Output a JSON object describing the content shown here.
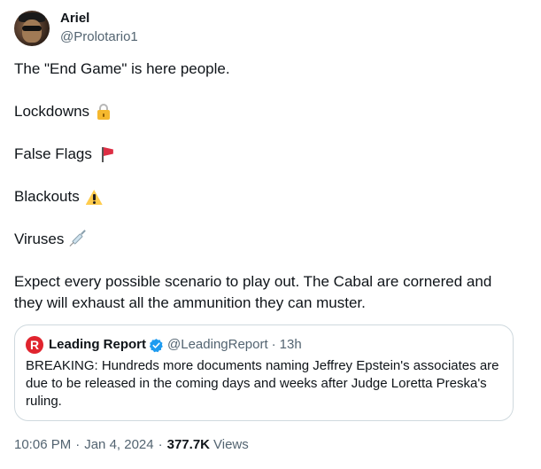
{
  "author": {
    "display_name": "Ariel",
    "handle": "@Prolotario1"
  },
  "tweet": {
    "intro": "The \"End Game\" is here people.",
    "items": [
      {
        "label": "Lockdowns",
        "icon": "lock-icon"
      },
      {
        "label": "False Flags",
        "icon": "red-flag-icon"
      },
      {
        "label": "Blackouts",
        "icon": "warning-icon"
      },
      {
        "label": "Viruses",
        "icon": "syringe-icon"
      }
    ],
    "closing": "Expect every possible scenario to play out. The Cabal are cornered and they will exhaust all the ammunition they can muster."
  },
  "quote": {
    "logo_letter": "R",
    "name": "Leading Report",
    "handle": "@LeadingReport",
    "dot": "·",
    "time": "13h",
    "text": "BREAKING: Hundreds more documents naming Jeffrey Epstein's associates are due to be released in the coming days and weeks after Judge Loretta Preska's ruling.",
    "logo_color": "#e0242e",
    "verified_color": "#1d9bf0"
  },
  "meta": {
    "time": "10:06 PM",
    "sep1": "·",
    "date": "Jan 4, 2024",
    "sep2": "·",
    "views_count": "377.7K",
    "views_label": "Views"
  }
}
